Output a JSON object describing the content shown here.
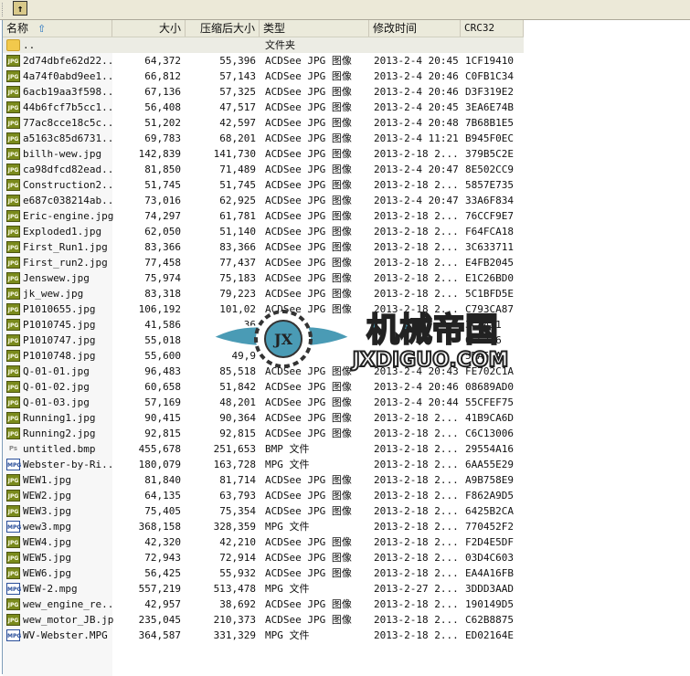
{
  "toolbar": {
    "up_icon": "up-folder-icon"
  },
  "header": {
    "name": "名称",
    "size": "大小",
    "packed": "压缩后大小",
    "type": "类型",
    "modified": "修改时间",
    "crc": "CRC32",
    "sort_icon": "sort-ascending-arrow-icon"
  },
  "parent": {
    "name": "..",
    "type": "文件夹"
  },
  "files": [
    {
      "icon": "jpg",
      "name": "2d74dbfe62d22...",
      "size": "64,372",
      "packed": "55,396",
      "type": "ACDSee JPG 图像",
      "date": "2013-2-4 20:45",
      "crc": "1CF19410"
    },
    {
      "icon": "jpg",
      "name": "4a74f0abd9ee1...",
      "size": "66,812",
      "packed": "57,143",
      "type": "ACDSee JPG 图像",
      "date": "2013-2-4 20:46",
      "crc": "C0FB1C34"
    },
    {
      "icon": "jpg",
      "name": "6acb19aa3f598...",
      "size": "67,136",
      "packed": "57,325",
      "type": "ACDSee JPG 图像",
      "date": "2013-2-4 20:46",
      "crc": "D3F319E2"
    },
    {
      "icon": "jpg",
      "name": "44b6fcf7b5cc1...",
      "size": "56,408",
      "packed": "47,517",
      "type": "ACDSee JPG 图像",
      "date": "2013-2-4 20:45",
      "crc": "3EA6E74B"
    },
    {
      "icon": "jpg",
      "name": "77ac8cce18c5c...",
      "size": "51,202",
      "packed": "42,597",
      "type": "ACDSee JPG 图像",
      "date": "2013-2-4 20:48",
      "crc": "7B68B1E5"
    },
    {
      "icon": "jpg",
      "name": "a5163c85d6731...",
      "size": "69,783",
      "packed": "68,201",
      "type": "ACDSee JPG 图像",
      "date": "2013-2-4 11:21",
      "crc": "B945F0EC"
    },
    {
      "icon": "jpg",
      "name": "billh-wew.jpg",
      "size": "142,839",
      "packed": "141,730",
      "type": "ACDSee JPG 图像",
      "date": "2013-2-18 2...",
      "crc": "379B5C2E"
    },
    {
      "icon": "jpg",
      "name": "ca98dfcd82ead...",
      "size": "81,850",
      "packed": "71,489",
      "type": "ACDSee JPG 图像",
      "date": "2013-2-4 20:47",
      "crc": "8E502CC9"
    },
    {
      "icon": "jpg",
      "name": "Construction2...",
      "size": "51,745",
      "packed": "51,745",
      "type": "ACDSee JPG 图像",
      "date": "2013-2-18 2...",
      "crc": "5857E735"
    },
    {
      "icon": "jpg",
      "name": "e687c038214ab...",
      "size": "73,016",
      "packed": "62,925",
      "type": "ACDSee JPG 图像",
      "date": "2013-2-4 20:47",
      "crc": "33A6F834"
    },
    {
      "icon": "jpg",
      "name": "Eric-engine.jpg",
      "size": "74,297",
      "packed": "61,781",
      "type": "ACDSee JPG 图像",
      "date": "2013-2-18 2...",
      "crc": "76CCF9E7"
    },
    {
      "icon": "jpg",
      "name": "Exploded1.jpg",
      "size": "62,050",
      "packed": "51,140",
      "type": "ACDSee JPG 图像",
      "date": "2013-2-18 2...",
      "crc": "F64FCA18"
    },
    {
      "icon": "jpg",
      "name": "First_Run1.jpg",
      "size": "83,366",
      "packed": "83,366",
      "type": "ACDSee JPG 图像",
      "date": "2013-2-18 2...",
      "crc": "3C633711"
    },
    {
      "icon": "jpg",
      "name": "First_run2.jpg",
      "size": "77,458",
      "packed": "77,437",
      "type": "ACDSee JPG 图像",
      "date": "2013-2-18 2...",
      "crc": "E4FB2045"
    },
    {
      "icon": "jpg",
      "name": "Jenswew.jpg",
      "size": "75,974",
      "packed": "75,183",
      "type": "ACDSee JPG 图像",
      "date": "2013-2-18 2...",
      "crc": "E1C26BD0"
    },
    {
      "icon": "jpg",
      "name": "jk_wew.jpg",
      "size": "83,318",
      "packed": "79,223",
      "type": "ACDSee JPG 图像",
      "date": "2013-2-18 2...",
      "crc": "5C1BFD5E"
    },
    {
      "icon": "jpg",
      "name": "P1010655.jpg",
      "size": "106,192",
      "packed": "101,02",
      "type": "ACDSee JPG 图像",
      "date": "2013-2-18 2...",
      "crc": "C793CA87"
    },
    {
      "icon": "jpg",
      "name": "P1010745.jpg",
      "size": "41,586",
      "packed": "36",
      "type": "",
      "date": "",
      "crc": "3CAA31"
    },
    {
      "icon": "jpg",
      "name": "P1010747.jpg",
      "size": "55,018",
      "packed": "",
      "type": "",
      "date": "",
      "crc": "065716"
    },
    {
      "icon": "jpg",
      "name": "P1010748.jpg",
      "size": "55,600",
      "packed": "49,9",
      "type": "",
      "date": "",
      "crc": "5DA59A"
    },
    {
      "icon": "jpg",
      "name": "Q-01-01.jpg",
      "size": "96,483",
      "packed": "85,518",
      "type": "ACDSee JPG 图像",
      "date": "2013-2-4 20:43",
      "crc": "FE702C1A"
    },
    {
      "icon": "jpg",
      "name": "Q-01-02.jpg",
      "size": "60,658",
      "packed": "51,842",
      "type": "ACDSee JPG 图像",
      "date": "2013-2-4 20:46",
      "crc": "08689AD0"
    },
    {
      "icon": "jpg",
      "name": "Q-01-03.jpg",
      "size": "57,169",
      "packed": "48,201",
      "type": "ACDSee JPG 图像",
      "date": "2013-2-4 20:44",
      "crc": "55CFEF75"
    },
    {
      "icon": "jpg",
      "name": "Running1.jpg",
      "size": "90,415",
      "packed": "90,364",
      "type": "ACDSee JPG 图像",
      "date": "2013-2-18 2...",
      "crc": "41B9CA6D"
    },
    {
      "icon": "jpg",
      "name": "Running2.jpg",
      "size": "92,815",
      "packed": "92,815",
      "type": "ACDSee JPG 图像",
      "date": "2013-2-18 2...",
      "crc": "C6C13006"
    },
    {
      "icon": "bmp",
      "name": "untitled.bmp",
      "size": "455,678",
      "packed": "251,653",
      "type": "BMP 文件",
      "date": "2013-2-18 2...",
      "crc": "29554A16"
    },
    {
      "icon": "mpg",
      "name": "Webster-by-Ri...",
      "size": "180,079",
      "packed": "163,728",
      "type": "MPG 文件",
      "date": "2013-2-18 2...",
      "crc": "6AA55E29"
    },
    {
      "icon": "jpg",
      "name": "WEW1.jpg",
      "size": "81,840",
      "packed": "81,714",
      "type": "ACDSee JPG 图像",
      "date": "2013-2-18 2...",
      "crc": "A9B758E9"
    },
    {
      "icon": "jpg",
      "name": "WEW2.jpg",
      "size": "64,135",
      "packed": "63,793",
      "type": "ACDSee JPG 图像",
      "date": "2013-2-18 2...",
      "crc": "F862A9D5"
    },
    {
      "icon": "jpg",
      "name": "WEW3.jpg",
      "size": "75,405",
      "packed": "75,354",
      "type": "ACDSee JPG 图像",
      "date": "2013-2-18 2...",
      "crc": "6425B2CA"
    },
    {
      "icon": "mpg",
      "name": "wew3.mpg",
      "size": "368,158",
      "packed": "328,359",
      "type": "MPG 文件",
      "date": "2013-2-18 2...",
      "crc": "770452F2"
    },
    {
      "icon": "jpg",
      "name": "WEW4.jpg",
      "size": "42,320",
      "packed": "42,210",
      "type": "ACDSee JPG 图像",
      "date": "2013-2-18 2...",
      "crc": "F2D4E5DF"
    },
    {
      "icon": "jpg",
      "name": "WEW5.jpg",
      "size": "72,943",
      "packed": "72,914",
      "type": "ACDSee JPG 图像",
      "date": "2013-2-18 2...",
      "crc": "03D4C603"
    },
    {
      "icon": "jpg",
      "name": "WEW6.jpg",
      "size": "56,425",
      "packed": "55,932",
      "type": "ACDSee JPG 图像",
      "date": "2013-2-18 2...",
      "crc": "EA4A16FB"
    },
    {
      "icon": "mpg",
      "name": "WEW-2.mpg",
      "size": "557,219",
      "packed": "513,478",
      "type": "MPG 文件",
      "date": "2013-2-27 2...",
      "crc": "3DDD3AAD"
    },
    {
      "icon": "jpg",
      "name": "wew_engine_re...",
      "size": "42,957",
      "packed": "38,692",
      "type": "ACDSee JPG 图像",
      "date": "2013-2-18 2...",
      "crc": "190149D5"
    },
    {
      "icon": "jpg",
      "name": "wew_motor_JB.jpg",
      "size": "235,045",
      "packed": "210,373",
      "type": "ACDSee JPG 图像",
      "date": "2013-2-18 2...",
      "crc": "C62B8875"
    },
    {
      "icon": "mpg",
      "name": "WV-Webster.MPG",
      "size": "364,587",
      "packed": "331,329",
      "type": "MPG 文件",
      "date": "2013-2-18 2...",
      "crc": "ED02164E"
    }
  ],
  "icon_labels": {
    "jpg": "JPG",
    "mpg": "MPG",
    "bmp": "Ps"
  },
  "watermark": {
    "text_cn": "机械帝国",
    "text_en": "JXDIGUO.COM",
    "badge": "JX",
    "color": "#4a9bb5"
  }
}
